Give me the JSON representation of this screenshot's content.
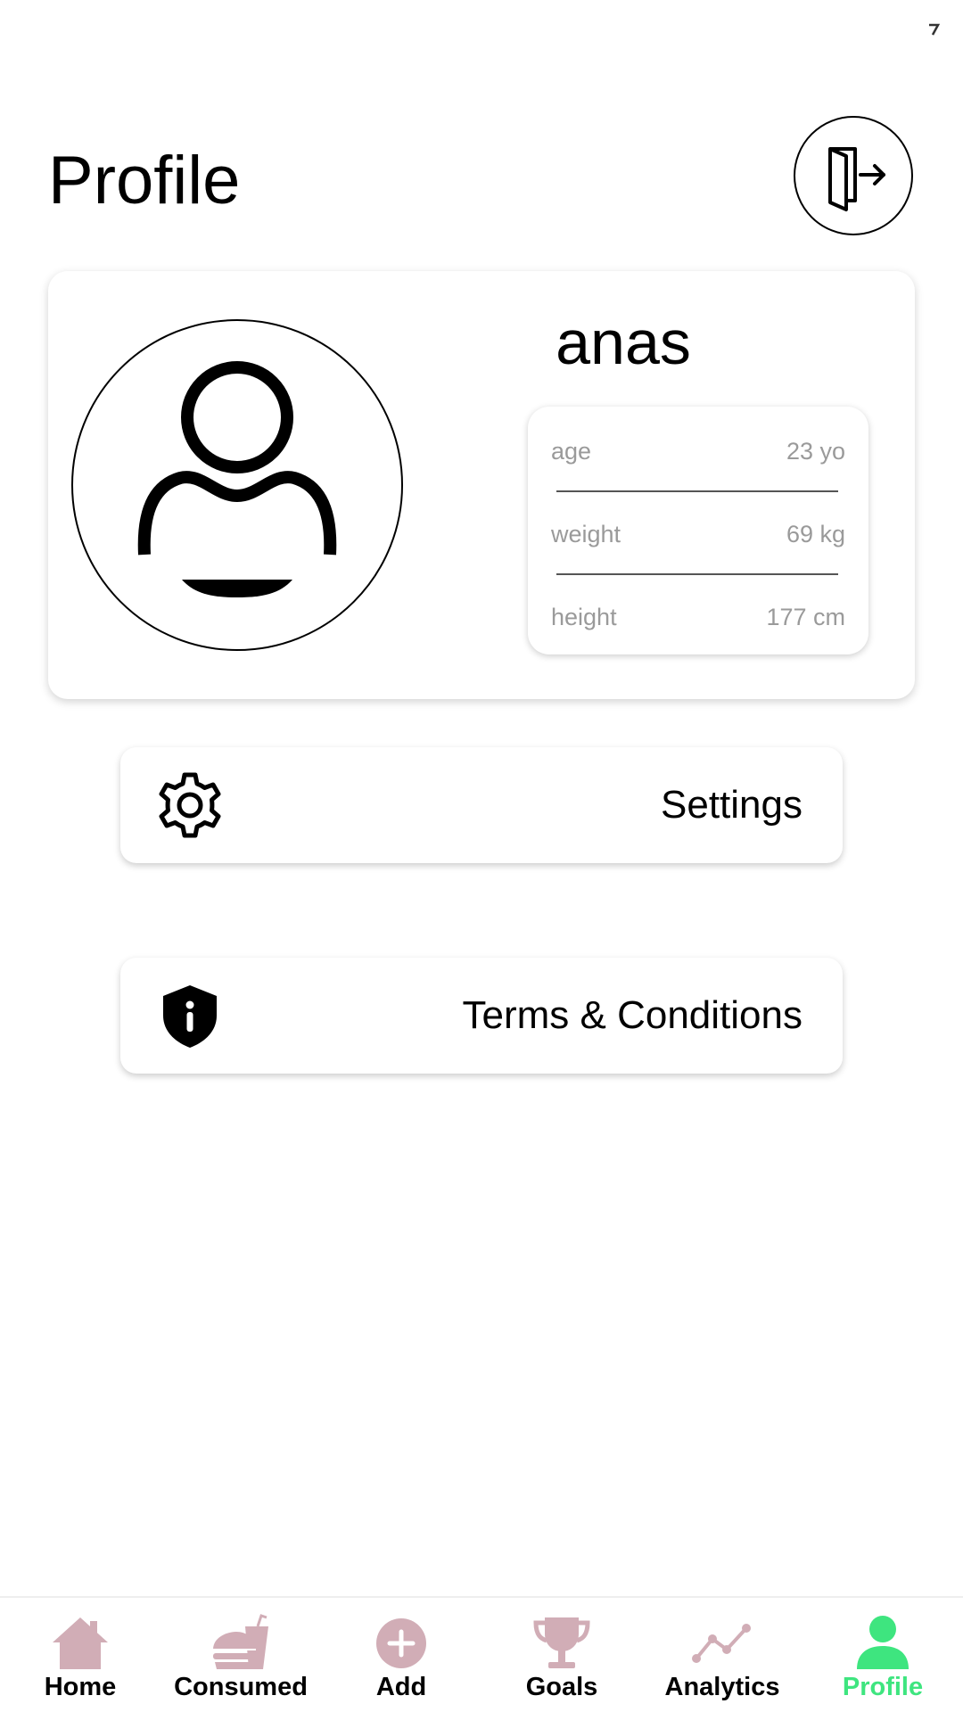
{
  "page": {
    "title": "Profile"
  },
  "profile": {
    "name": "anas",
    "stats": [
      {
        "label": "age",
        "value": "23 yo"
      },
      {
        "label": "weight",
        "value": "69 kg"
      },
      {
        "label": "height",
        "value": "177 cm"
      }
    ]
  },
  "menu": {
    "settings_label": "Settings",
    "terms_label": "Terms & Conditions"
  },
  "bottom_nav": {
    "items": [
      {
        "label": "Home",
        "icon": "home-icon",
        "active": false
      },
      {
        "label": "Consumed",
        "icon": "fast-food-icon",
        "active": false
      },
      {
        "label": "Add",
        "icon": "add-circle-icon",
        "active": false
      },
      {
        "label": "Goals",
        "icon": "trophy-icon",
        "active": false
      },
      {
        "label": "Analytics",
        "icon": "analytics-icon",
        "active": false
      },
      {
        "label": "Profile",
        "icon": "person-icon",
        "active": true
      }
    ]
  },
  "colors": {
    "inactive_icon": "#d1adb6",
    "active": "#3ee57f",
    "stat_text": "#9a9a9a"
  }
}
